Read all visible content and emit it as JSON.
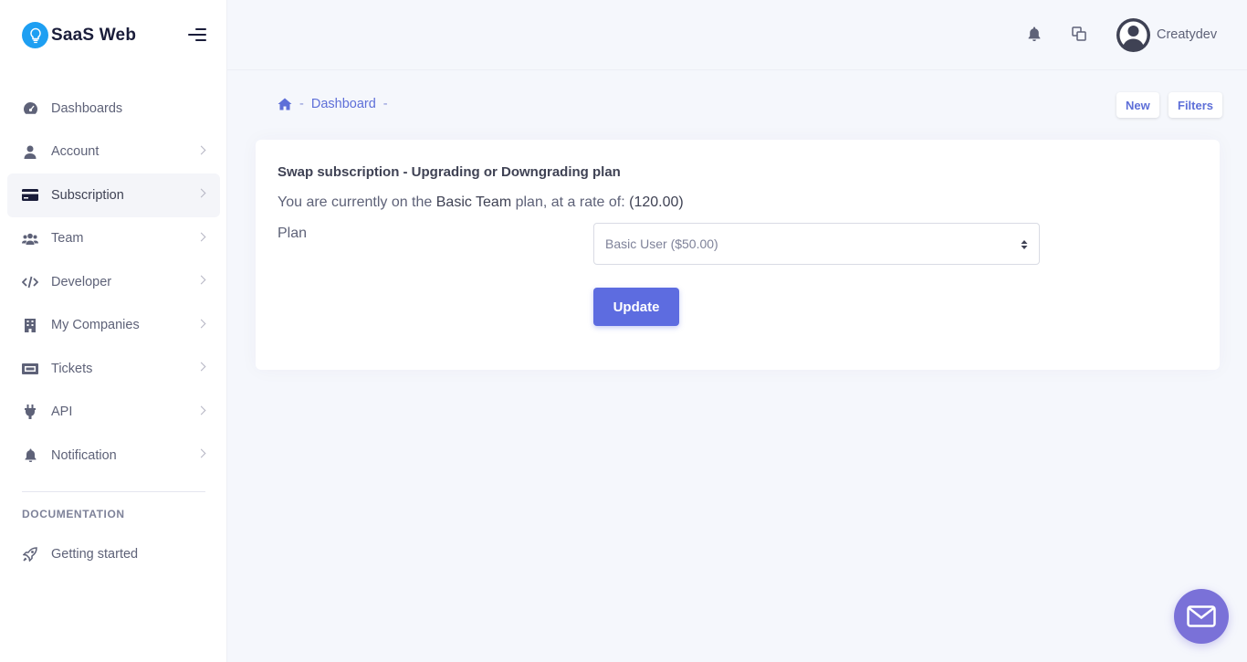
{
  "brand": {
    "name": "SaaS Web",
    "accent": "#1e9ff2"
  },
  "sidebar": {
    "items": [
      {
        "label": "Dashboards",
        "icon": "dashboard-icon"
      },
      {
        "label": "Account",
        "icon": "user-icon"
      },
      {
        "label": "Subscription",
        "icon": "credit-card-icon",
        "active": true
      },
      {
        "label": "Team",
        "icon": "users-icon"
      },
      {
        "label": "Developer",
        "icon": "code-icon"
      },
      {
        "label": "My Companies",
        "icon": "building-icon"
      },
      {
        "label": "Tickets",
        "icon": "ticket-icon"
      },
      {
        "label": "API",
        "icon": "plug-icon"
      },
      {
        "label": "Notification",
        "icon": "bell-icon"
      }
    ],
    "section_title": "DOCUMENTATION",
    "doc_item": {
      "label": "Getting started",
      "icon": "rocket-icon"
    }
  },
  "header": {
    "username": "Creatydev"
  },
  "breadcrumb": {
    "item": "Dashboard"
  },
  "toolbar": {
    "new_label": "New",
    "filters_label": "Filters"
  },
  "card": {
    "title": "Swap subscription - Upgrading or Downgrading plan",
    "text_prefix": "You are currently on the ",
    "plan_name": "Basic Team",
    "text_middle": " plan, at a rate of: ",
    "rate": "(120.00)",
    "plan_label": "Plan",
    "select_value": "Basic User ($50.00)",
    "update_label": "Update"
  },
  "colors": {
    "primary": "#5d6ce0",
    "fab": "#7a71d8"
  }
}
